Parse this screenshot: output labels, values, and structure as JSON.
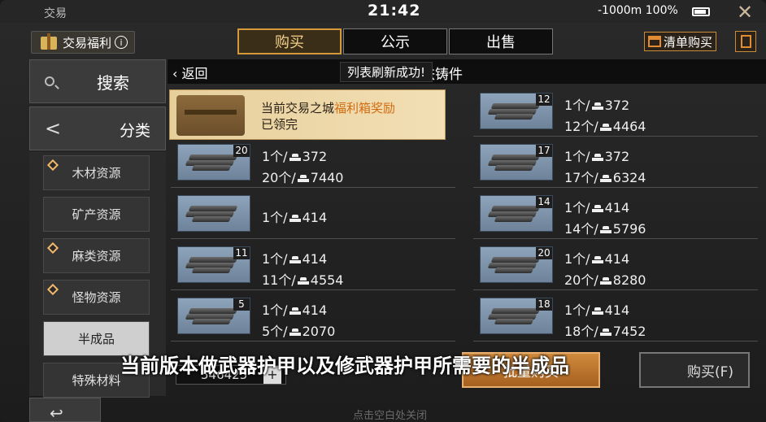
{
  "status": {
    "carrier": "交易",
    "clock": "21:42",
    "signal": "-1000m 100%"
  },
  "header": {
    "welfare_label": "交易福利",
    "info_symbol": "i",
    "tabs": [
      {
        "label": "购买"
      },
      {
        "label": "公示"
      },
      {
        "label": "出售"
      }
    ],
    "list_buy_label": "清单购买"
  },
  "sidebar": {
    "search_label": "搜索",
    "category_label": "分类",
    "categories": [
      {
        "label": "木材资源"
      },
      {
        "label": "矿产资源"
      },
      {
        "label": "麻类资源"
      },
      {
        "label": "怪物资源"
      },
      {
        "label": "半成品"
      },
      {
        "label": "特殊材料"
      }
    ]
  },
  "main": {
    "back_label": "返回",
    "toast": "列表刷新成功!",
    "title": "铁铸件",
    "reward": {
      "line1_prefix": "当前交易之城",
      "line1_highlight": "福利箱奖励",
      "line2": "已领完"
    },
    "items": [
      {
        "qty": "12",
        "unit": "1个/",
        "unit_price": "372",
        "bulk": "12个/",
        "bulk_price": "4464"
      },
      {
        "qty": "20",
        "unit": "1个/",
        "unit_price": "372",
        "bulk": "20个/",
        "bulk_price": "7440"
      },
      {
        "qty": "17",
        "unit": "1个/",
        "unit_price": "372",
        "bulk": "17个/",
        "bulk_price": "6324"
      },
      {
        "qty": "",
        "unit": "1个/",
        "unit_price": "414"
      },
      {
        "qty": "14",
        "unit": "1个/",
        "unit_price": "414",
        "bulk": "14个/",
        "bulk_price": "5796"
      },
      {
        "qty": "11",
        "unit": "1个/",
        "unit_price": "414",
        "bulk": "11个/",
        "bulk_price": "4554"
      },
      {
        "qty": "20",
        "unit": "1个/",
        "unit_price": "414",
        "bulk": "20个/",
        "bulk_price": "8280"
      },
      {
        "qty": "5",
        "unit": "1个/",
        "unit_price": "414",
        "bulk": "5个/",
        "bulk_price": "2070"
      },
      {
        "qty": "18",
        "unit": "1个/",
        "unit_price": "414",
        "bulk": "18个/",
        "bulk_price": "7452"
      }
    ],
    "total_partial": "546425",
    "bulk_buy_label": "批量购买",
    "buy_label": "购买(F)"
  },
  "overlay": {
    "subtitle": "当前版本做武器护甲以及修武器护甲所需要的半成品",
    "hint": "点击空白处关闭"
  }
}
